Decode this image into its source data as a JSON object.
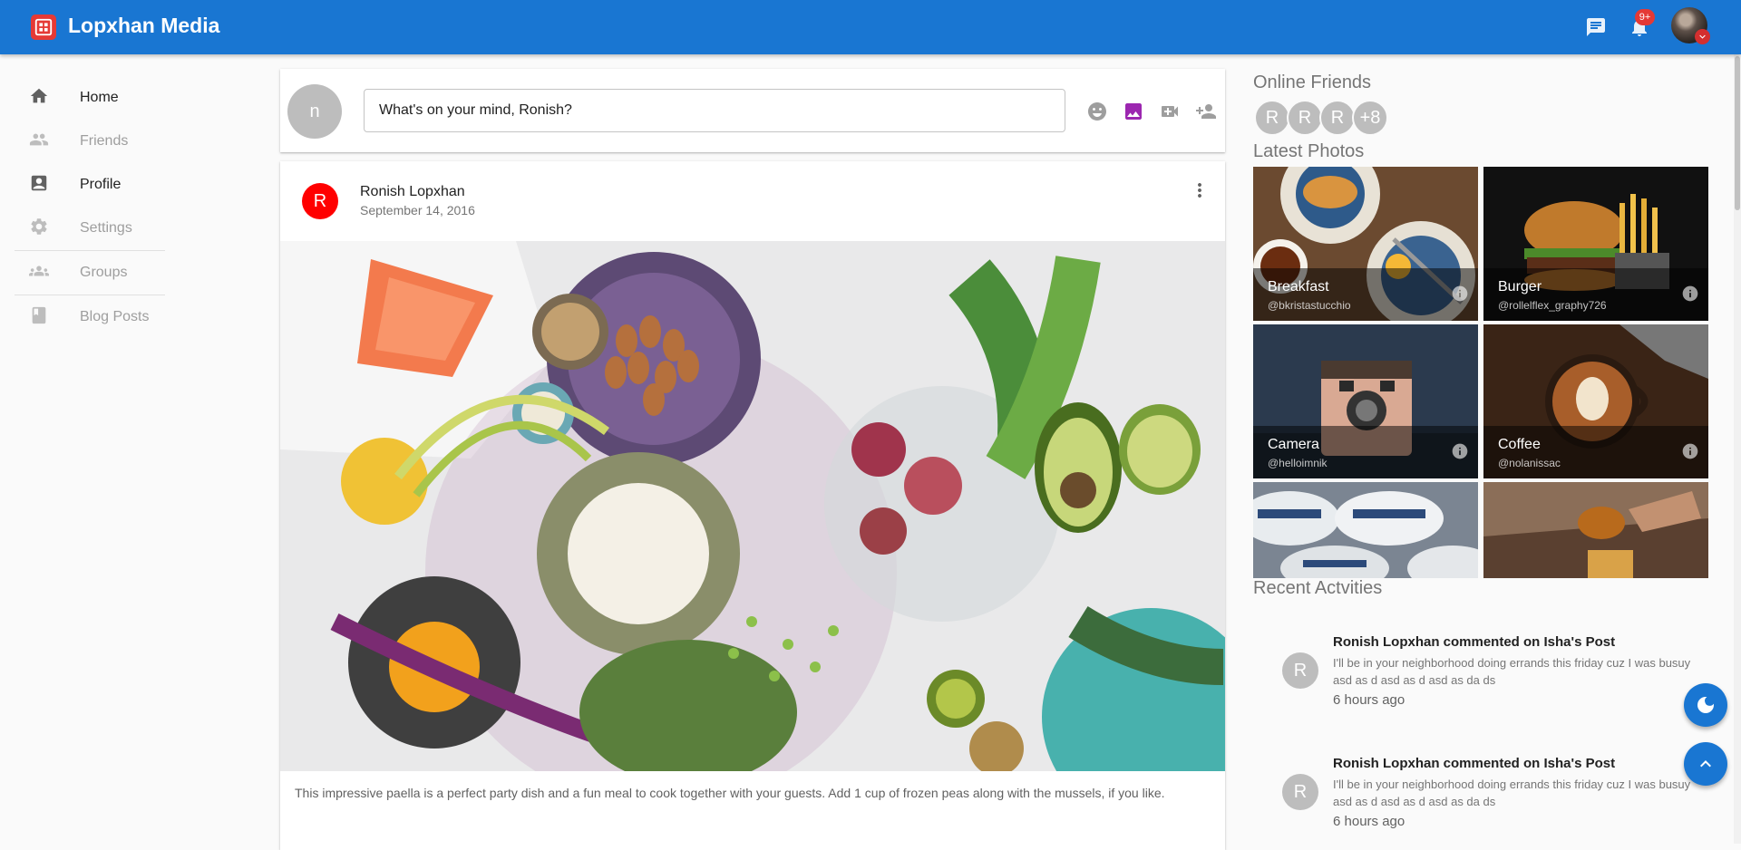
{
  "app": {
    "title": "Lopxhan Media",
    "notification_badge": "9+",
    "accent": "#1976d2"
  },
  "nav": {
    "items": [
      {
        "label": "Home",
        "icon": "home-icon",
        "active": true
      },
      {
        "label": "Friends",
        "icon": "people-icon",
        "active": false
      },
      {
        "label": "Profile",
        "icon": "profile-icon",
        "active": true
      },
      {
        "label": "Settings",
        "icon": "gear-icon",
        "active": false
      },
      {
        "label": "Groups",
        "icon": "groups-icon",
        "active": false
      },
      {
        "label": "Blog Posts",
        "icon": "book-icon",
        "active": false
      }
    ]
  },
  "composer": {
    "avatar_letter": "n",
    "placeholder": "What's on your mind, Ronish?"
  },
  "post": {
    "avatar_letter": "R",
    "author": "Ronish Lopxhan",
    "date": "September 14, 2016",
    "caption": "This impressive paella is a perfect party dish and a fun meal to cook together with your guests. Add 1 cup of frozen peas along with the mussels, if you like."
  },
  "online_friends": {
    "title": "Online Friends",
    "avatars": [
      "R",
      "R",
      "R"
    ],
    "more": "+8"
  },
  "latest_photos": {
    "title": "Latest Photos",
    "items": [
      {
        "title": "Breakfast",
        "author": "@bkristastucchio"
      },
      {
        "title": "Burger",
        "author": "@rollelflex_graphy726"
      },
      {
        "title": "Camera",
        "author": "@helloimnik"
      },
      {
        "title": "Coffee",
        "author": "@nolanissac"
      }
    ]
  },
  "recent_activities": {
    "title": "Recent Actvities",
    "items": [
      {
        "avatar": "R",
        "title": "Ronish Lopxhan commented on Isha's Post",
        "body": "I'll be in your neighborhood doing errands this friday cuz I was busuy asd as d asd as d asd as da ds",
        "time": "6 hours ago"
      },
      {
        "avatar": "R",
        "title": "Ronish Lopxhan commented on Isha's Post",
        "body": "I'll be in your neighborhood doing errands this friday cuz I was busuy asd as d asd as d asd as da ds",
        "time": "6 hours ago"
      }
    ]
  }
}
